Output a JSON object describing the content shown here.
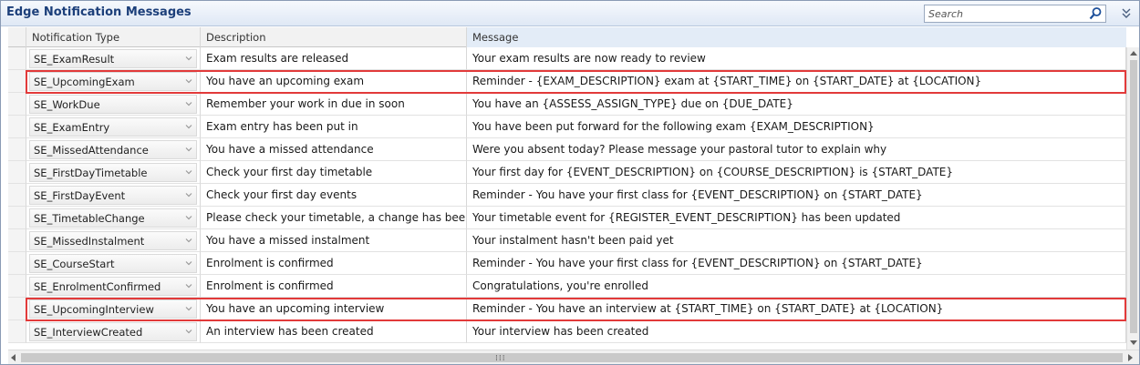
{
  "window": {
    "title": "Edge Notification Messages"
  },
  "search": {
    "placeholder": "Search"
  },
  "table": {
    "columns": [
      "Notification Type",
      "Description",
      "Message"
    ],
    "rows": [
      {
        "type": "SE_ExamResult",
        "description": "Exam results are released",
        "message": "Your exam results are now ready to review"
      },
      {
        "type": "SE_UpcomingExam",
        "description": "You have an upcoming exam",
        "message": "Reminder - {EXAM_DESCRIPTION} exam at {START_TIME} on {START_DATE} at {LOCATION}"
      },
      {
        "type": "SE_WorkDue",
        "description": "Remember your work in due in soon",
        "message": "You have an {ASSESS_ASSIGN_TYPE} due on {DUE_DATE}"
      },
      {
        "type": "SE_ExamEntry",
        "description": "Exam entry has been put in",
        "message": "You have been put forward for the following exam {EXAM_DESCRIPTION}"
      },
      {
        "type": "SE_MissedAttendance",
        "description": "You have a missed attendance",
        "message": "Were you absent today? Please message your pastoral tutor to explain why"
      },
      {
        "type": "SE_FirstDayTimetable",
        "description": "Check your first day timetable",
        "message": "Your first day for {EVENT_DESCRIPTION} on {COURSE_DESCRIPTION} is {START_DATE}"
      },
      {
        "type": "SE_FirstDayEvent",
        "description": "Check your first day events",
        "message": "Reminder - You have your first class for {EVENT_DESCRIPTION} on {START_DATE}"
      },
      {
        "type": "SE_TimetableChange",
        "description": "Please check your timetable, a change has been made",
        "message": "Your timetable event for {REGISTER_EVENT_DESCRIPTION} has been updated"
      },
      {
        "type": "SE_MissedInstalment",
        "description": "You have a missed instalment",
        "message": "Your instalment hasn't been paid yet"
      },
      {
        "type": "SE_CourseStart",
        "description": "Enrolment is confirmed",
        "message": "Reminder - You have your first class for {EVENT_DESCRIPTION} on {START_DATE}"
      },
      {
        "type": "SE_EnrolmentConfirmed",
        "description": "Enrolment is confirmed",
        "message": "Congratulations, you're enrolled"
      },
      {
        "type": "SE_UpcomingInterview",
        "description": "You have an upcoming interview",
        "message": "Reminder - You have an interview at {START_TIME} on {START_DATE} at {LOCATION}"
      },
      {
        "type": "SE_InterviewCreated",
        "description": "An interview has been created",
        "message": "Your interview has been created"
      }
    ],
    "highlighted_rows": [
      1,
      11
    ]
  },
  "colors": {
    "title": "#1c3f7a",
    "highlight_border": "#e23a3a",
    "header_bg": "#f2f2f2"
  },
  "icons": {
    "search": "magnifier-icon",
    "collapse": "double-chevron-down-icon",
    "combo": "chevron-down-icon"
  }
}
